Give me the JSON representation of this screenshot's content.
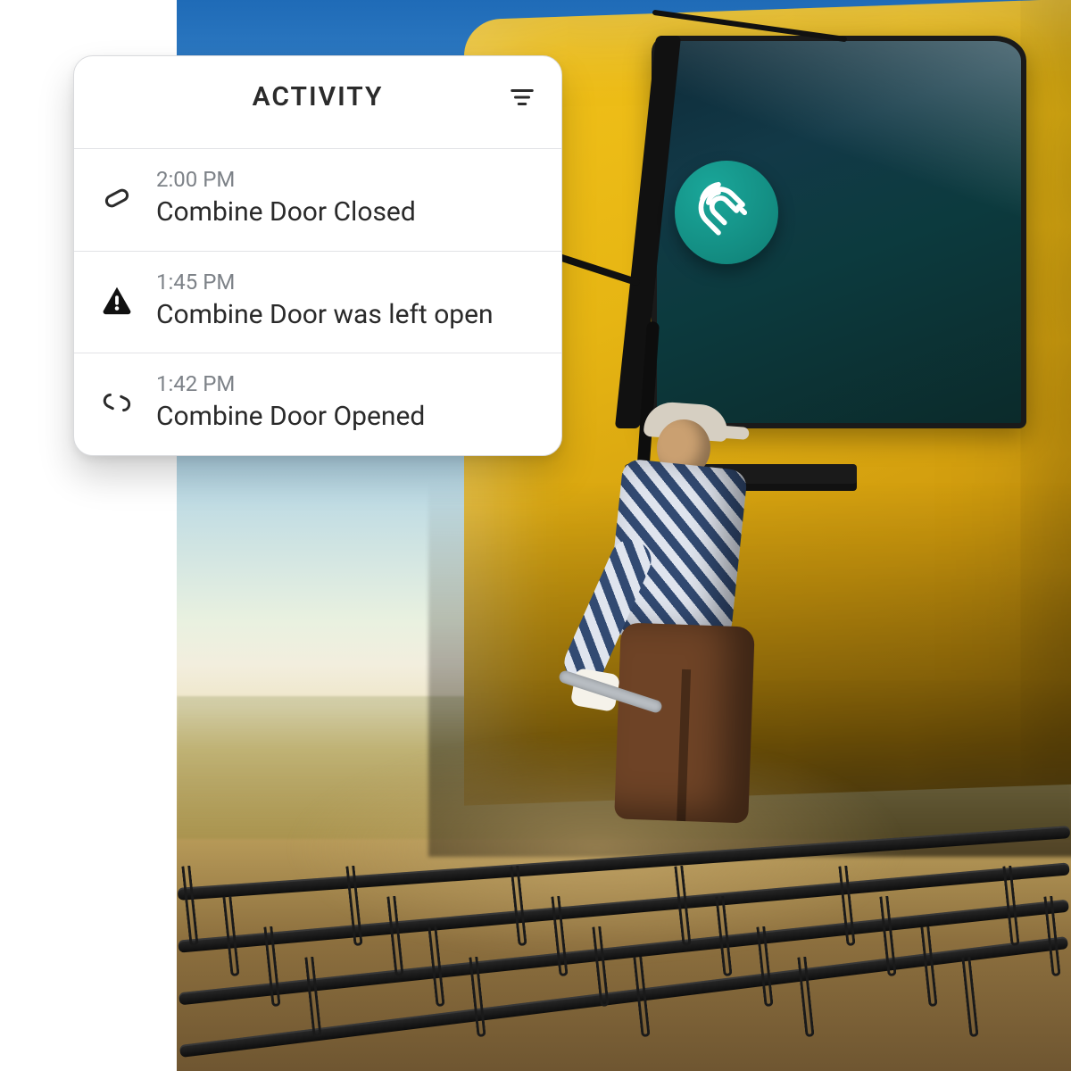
{
  "card": {
    "title": "ACTIVITY",
    "filter_label": "Filter"
  },
  "activity": [
    {
      "time": "2:00 PM",
      "message": "Combine Door Closed",
      "icon": "pill"
    },
    {
      "time": "1:45 PM",
      "message": "Combine Door was left open",
      "icon": "warning"
    },
    {
      "time": "1:42 PM",
      "message": "Combine Door Opened",
      "icon": "open-pill"
    }
  ],
  "badge": {
    "name": "sensor-magnet"
  },
  "colors": {
    "badge": "#169488",
    "text": "#2a2a2a",
    "muted": "#7d8288",
    "border": "#e2e3e6"
  }
}
